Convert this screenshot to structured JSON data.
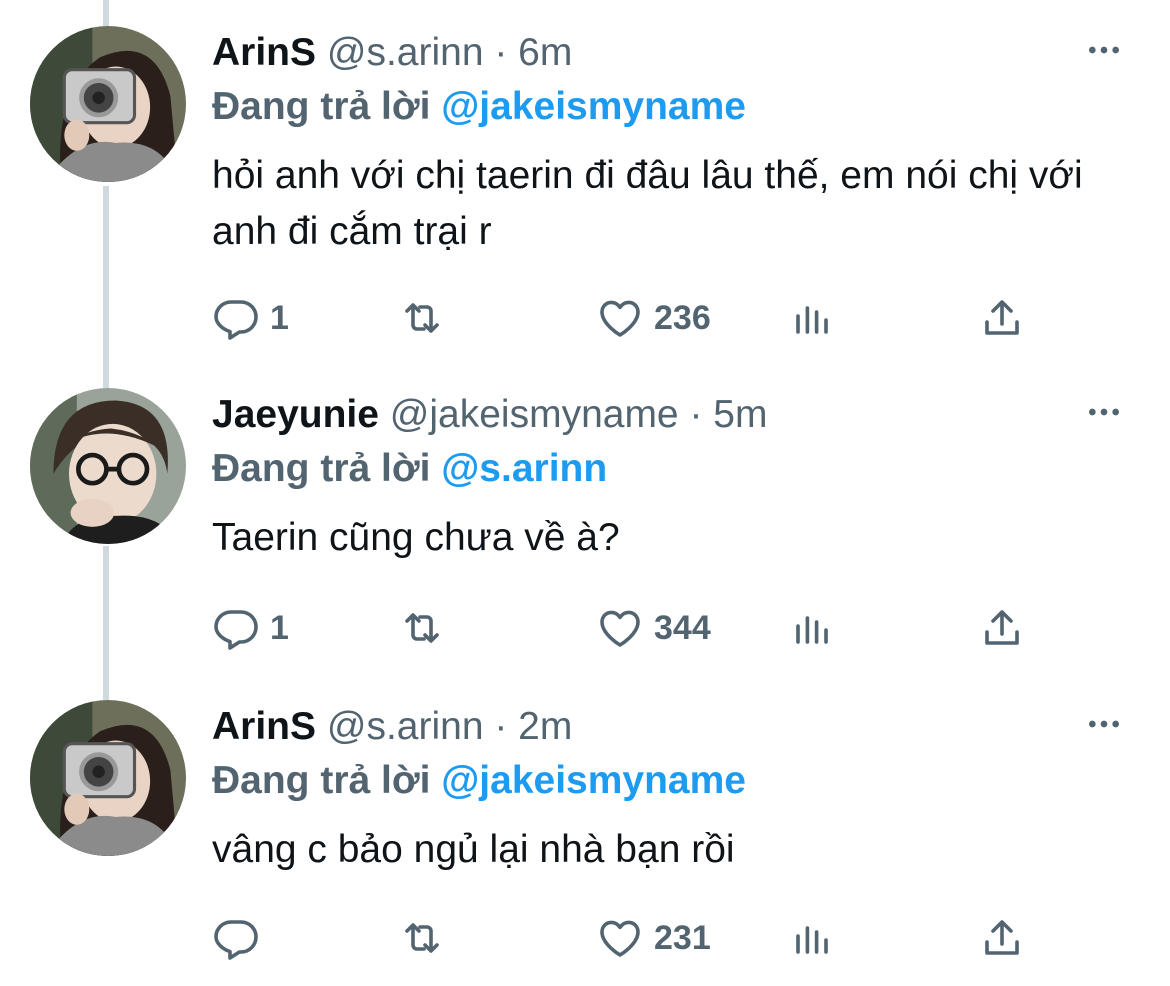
{
  "reply_prefix": "Đang trả lời",
  "tweets": [
    {
      "name": "ArinS",
      "handle": "@s.arinn",
      "time": "· 6m",
      "replying_to": "@jakeismyname",
      "text": "hỏi anh với chị taerin đi đâu lâu thế, em nói chị với anh đi cắm trại r",
      "replies": "1",
      "retweets": "",
      "likes": "236",
      "avatar_icon": "avatar-girl-camera"
    },
    {
      "name": "Jaeyunie",
      "handle": "@jakeismyname",
      "time": "· 5m",
      "replying_to": "@s.arinn",
      "text": "Taerin cũng chưa về à?",
      "replies": "1",
      "retweets": "",
      "likes": "344",
      "avatar_icon": "avatar-boy-glasses"
    },
    {
      "name": "ArinS",
      "handle": "@s.arinn",
      "time": "· 2m",
      "replying_to": "@jakeismyname",
      "text": "vâng c bảo ngủ lại nhà bạn rồi",
      "replies": "",
      "retweets": "",
      "likes": "231",
      "avatar_icon": "avatar-girl-camera"
    }
  ],
  "colors": {
    "accent": "#1d9bf0",
    "secondary_text": "#536471",
    "primary_text": "#0f1419",
    "thread_line": "#cfd9de"
  }
}
